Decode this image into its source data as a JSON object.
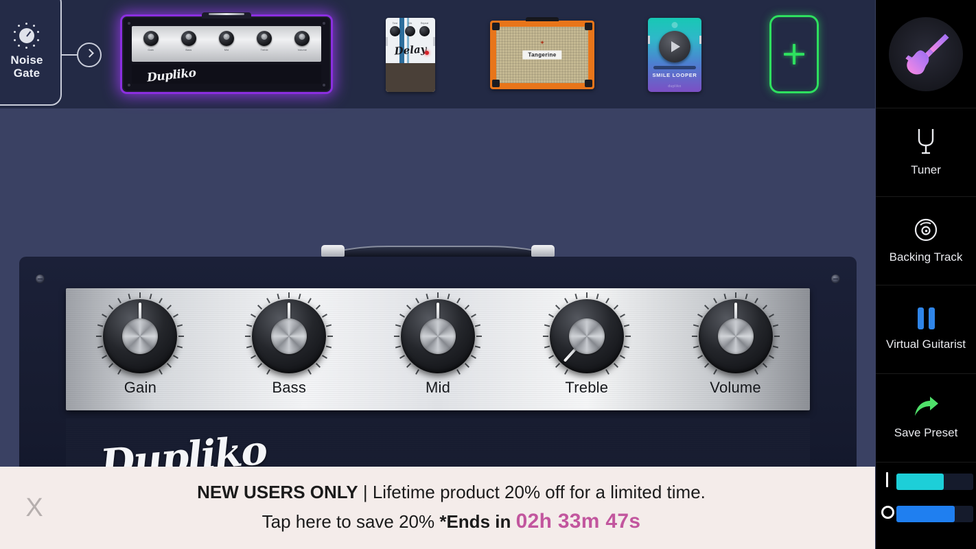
{
  "chain": {
    "noise_gate": {
      "label_line1": "Noise",
      "label_line2": "Gate"
    },
    "amp_head": {
      "name": "Dupliko",
      "knob_labels": [
        "Gain",
        "Bass",
        "Mid",
        "Treble",
        "Volume"
      ]
    },
    "delay_pedal": {
      "name": "Delay",
      "knob_labels": [
        "Time",
        "Mix",
        "Repeat"
      ]
    },
    "cabinet": {
      "name": "Tangerine"
    },
    "looper_pedal": {
      "name": "SMILE LOOPER",
      "sub": "dupliko"
    },
    "add_button": {
      "glyph": "+"
    }
  },
  "amp": {
    "brand": "Dupliko",
    "knobs": [
      {
        "label": "Gain",
        "angle": 0
      },
      {
        "label": "Bass",
        "angle": 0
      },
      {
        "label": "Mid",
        "angle": 0
      },
      {
        "label": "Treble",
        "angle": -138
      },
      {
        "label": "Volume",
        "angle": 0
      }
    ]
  },
  "sidebar": {
    "preset_icon": "guitar-icon",
    "items": [
      {
        "label": "Tuner",
        "icon": "tuning-fork-icon"
      },
      {
        "label": "Backing Track",
        "icon": "disc-icon"
      },
      {
        "label": "Virtual Guitarist",
        "icon": "pause-icon"
      },
      {
        "label": "Save Preset",
        "icon": "share-arrow-icon"
      }
    ],
    "sliders": [
      {
        "name": "input",
        "marker": "I",
        "value": 62,
        "color": "#1dcfd8"
      },
      {
        "name": "output",
        "marker": "O",
        "value": 76,
        "color": "#1f7ff0"
      }
    ]
  },
  "banner": {
    "close_label": "X",
    "headline_strong": "NEW USERS ONLY",
    "headline_sep": " | ",
    "headline_rest": "Lifetime product 20% off for a limited time.",
    "cta": "Tap here to save 20% ",
    "ends_label": "*Ends in ",
    "timer": "02h 33m 47s"
  }
}
